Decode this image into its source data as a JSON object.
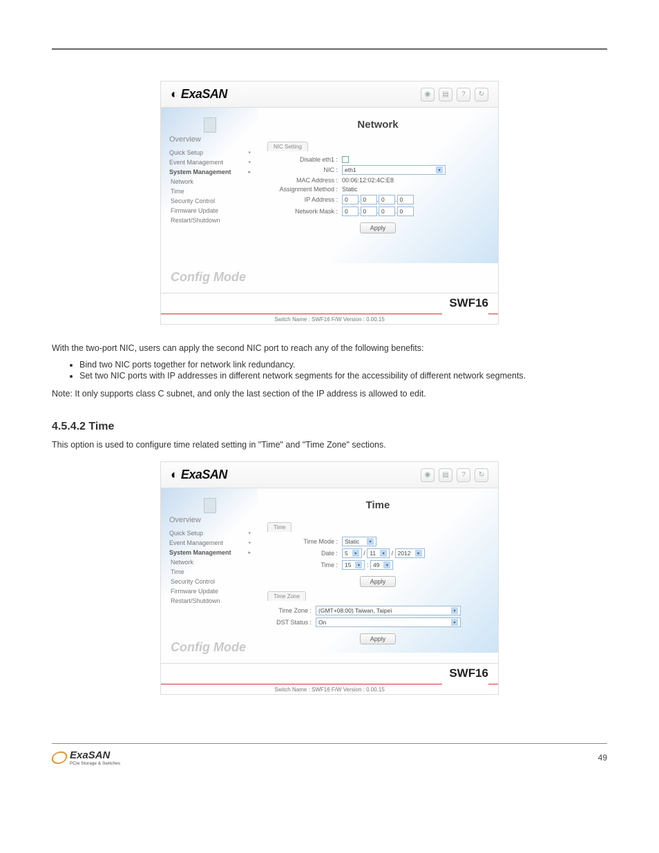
{
  "doc": {
    "heading_time": "4.5.4.2 Time",
    "para_network_intro": "With the two-port NIC, users can apply the second NIC port to reach any of the following benefits:",
    "bullets": [
      "Bind two NIC ports together for network link redundancy.",
      "Set two NIC ports with IP addresses in different network segments for the accessibility of different network segments."
    ],
    "para_note": "Note: It only supports class C subnet, and only the last section of the IP address is allowed to edit.",
    "para_time_intro": "This option is used to configure time related setting in \"Time\" and \"Time Zone\" sections.",
    "page_number": "49"
  },
  "footer_logo": {
    "brand": "ExaSAN",
    "sub": "PCIe Storage & Switches"
  },
  "brand": "ExaSAN",
  "top_icons": [
    "eye-icon",
    "doc-icon",
    "help-icon",
    "refresh-icon"
  ],
  "sidebar": {
    "overview": "Overview",
    "items": [
      {
        "label": "Quick Setup",
        "marker": "▾"
      },
      {
        "label": "Event Management",
        "marker": "▾"
      },
      {
        "label": "System Management",
        "marker": "▸"
      }
    ],
    "sub_items": [
      "Network",
      "Time",
      "Security Control",
      "Firmware Update",
      "Restart/Shutdown"
    ]
  },
  "config_mode": "Config Mode",
  "model": "SWF16",
  "status_bar": "Switch Name : SWF16 F/W Version : 0.00.15",
  "network": {
    "title": "Network",
    "tab": "NIC Setting",
    "rows": {
      "disable_label": "Disable eth1 :",
      "nic_label": "NIC :",
      "nic_value": "eth1",
      "mac_label": "MAC Address :",
      "mac_value": "00:06:12:02:4C:E8",
      "assign_label": "Assignment Method :",
      "assign_value": "Static",
      "ip_label": "IP Address :",
      "mask_label": "Network Mask :",
      "octets": [
        "0",
        "0",
        "0",
        "0"
      ],
      "apply": "Apply"
    }
  },
  "time": {
    "title": "Time",
    "tab1": "Time",
    "tab2": "Time Zone",
    "rows": {
      "mode_label": "Time Mode :",
      "mode_value": "Static",
      "date_label": "Date :",
      "date_m": "5",
      "date_d": "11",
      "date_y": "2012",
      "time_label": "Time :",
      "time_h": "15",
      "time_m": "49",
      "tz_label": "Time Zone :",
      "tz_value": "(GMT+08:00) Taiwan, Taipei",
      "dst_label": "DST Status :",
      "dst_value": "On",
      "apply": "Apply"
    }
  }
}
